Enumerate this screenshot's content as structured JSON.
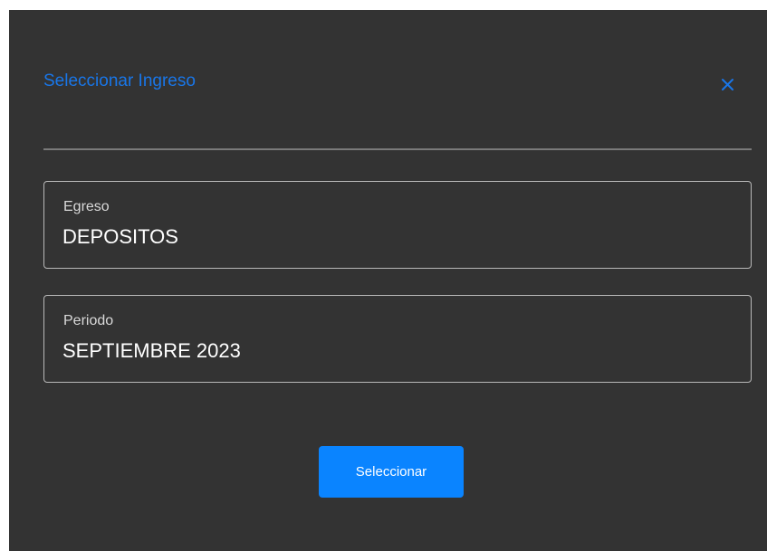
{
  "dialog": {
    "title": "Seleccionar Ingreso",
    "close_icon": "close-icon",
    "accent_color": "#1976e8",
    "background_color": "#333333"
  },
  "fields": [
    {
      "label": "Egreso",
      "value": "DEPOSITOS"
    },
    {
      "label": "Periodo",
      "value": "SEPTIEMBRE 2023"
    }
  ],
  "actions": {
    "select_label": "Seleccionar",
    "select_color": "#0a84ff"
  }
}
